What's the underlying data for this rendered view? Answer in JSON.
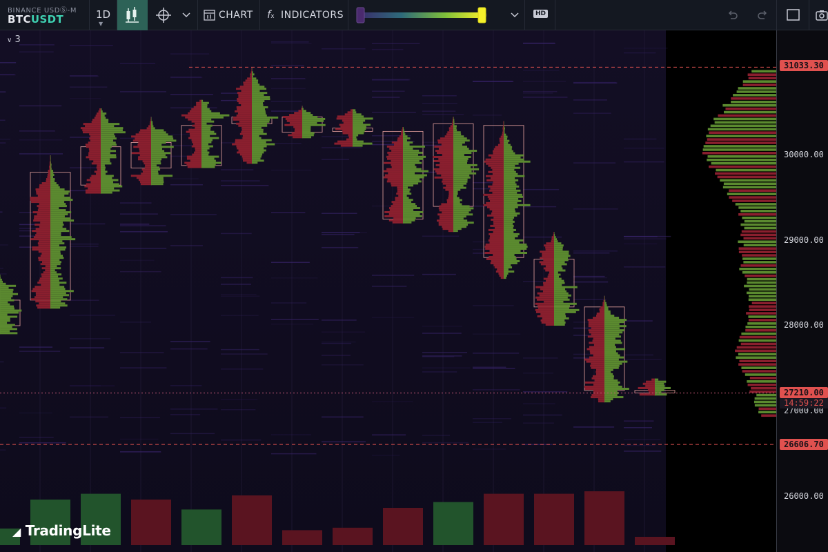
{
  "toolbar": {
    "exchange": "BINANCE USDⓈ-M",
    "symbol_base": "BTC",
    "symbol_quote": "USDT",
    "timeframe": "1D",
    "chart_label": "CHART",
    "indicators_label": "INDICATORS",
    "hd_label": "HD",
    "slider_colors": [
      "#4a2a6e",
      "#f5f02a"
    ],
    "icons": [
      "candles-icon",
      "crosshair-icon",
      "chevron-down-icon",
      "chart-template-icon",
      "function-icon",
      "undo-icon",
      "redo-icon",
      "fullscreen-icon",
      "camera-icon"
    ]
  },
  "pane": {
    "collapse_count": "3"
  },
  "brand": "TradingLite",
  "price_scale": {
    "ticks": [
      "30000.00",
      "29000.00",
      "28000.00",
      "27000.00",
      "26000.00"
    ],
    "high_badge": "31033.30",
    "current_badge": "27210.00",
    "countdown": "14:59:22",
    "low_badge": "26606.70"
  },
  "chart_data": {
    "type": "candlestick",
    "ylim": [
      25800,
      31300
    ],
    "ticks": [
      26000,
      27000,
      28000,
      29000,
      30000
    ],
    "horizontal_lines": [
      31033.3,
      27210.0,
      26606.7
    ],
    "colors": {
      "up": "#5b8a2f",
      "down": "#8a1f2e",
      "box": "#e8a3a0",
      "heat": "#3b2670"
    },
    "candles": [
      {
        "open": 28000,
        "close": 28300,
        "high": 28600,
        "low": 27900,
        "vol": 0.2,
        "dir": "up"
      },
      {
        "open": 28300,
        "close": 29800,
        "high": 30000,
        "low": 28200,
        "vol": 0.55,
        "dir": "up"
      },
      {
        "open": 30100,
        "close": 29650,
        "high": 30550,
        "low": 29550,
        "vol": 0.62,
        "dir": "up"
      },
      {
        "open": 30150,
        "close": 29850,
        "high": 30450,
        "low": 29650,
        "vol": 0.55,
        "dir": "down"
      },
      {
        "open": 29880,
        "close": 30350,
        "high": 30650,
        "low": 29850,
        "vol": 0.43,
        "dir": "up"
      },
      {
        "open": 30450,
        "close": 30370,
        "high": 31033,
        "low": 29900,
        "vol": 0.6,
        "dir": "down"
      },
      {
        "open": 30450,
        "close": 30270,
        "high": 30580,
        "low": 30200,
        "vol": 0.18,
        "dir": "down"
      },
      {
        "open": 30320,
        "close": 30280,
        "high": 30540,
        "low": 30100,
        "vol": 0.21,
        "dir": "down"
      },
      {
        "open": 30280,
        "close": 29250,
        "high": 30330,
        "low": 29200,
        "vol": 0.45,
        "dir": "down"
      },
      {
        "open": 29400,
        "close": 30370,
        "high": 30450,
        "low": 29100,
        "vol": 0.52,
        "dir": "up"
      },
      {
        "open": 30350,
        "close": 28800,
        "high": 30400,
        "low": 28550,
        "vol": 0.62,
        "dir": "down"
      },
      {
        "open": 28780,
        "close": 28220,
        "high": 29100,
        "low": 28000,
        "vol": 0.62,
        "dir": "down"
      },
      {
        "open": 28220,
        "close": 27240,
        "high": 28350,
        "low": 27100,
        "vol": 0.65,
        "dir": "down"
      },
      {
        "open": 27240,
        "close": 27210,
        "high": 27380,
        "low": 27180,
        "vol": 0.1,
        "dir": "down"
      }
    ]
  }
}
